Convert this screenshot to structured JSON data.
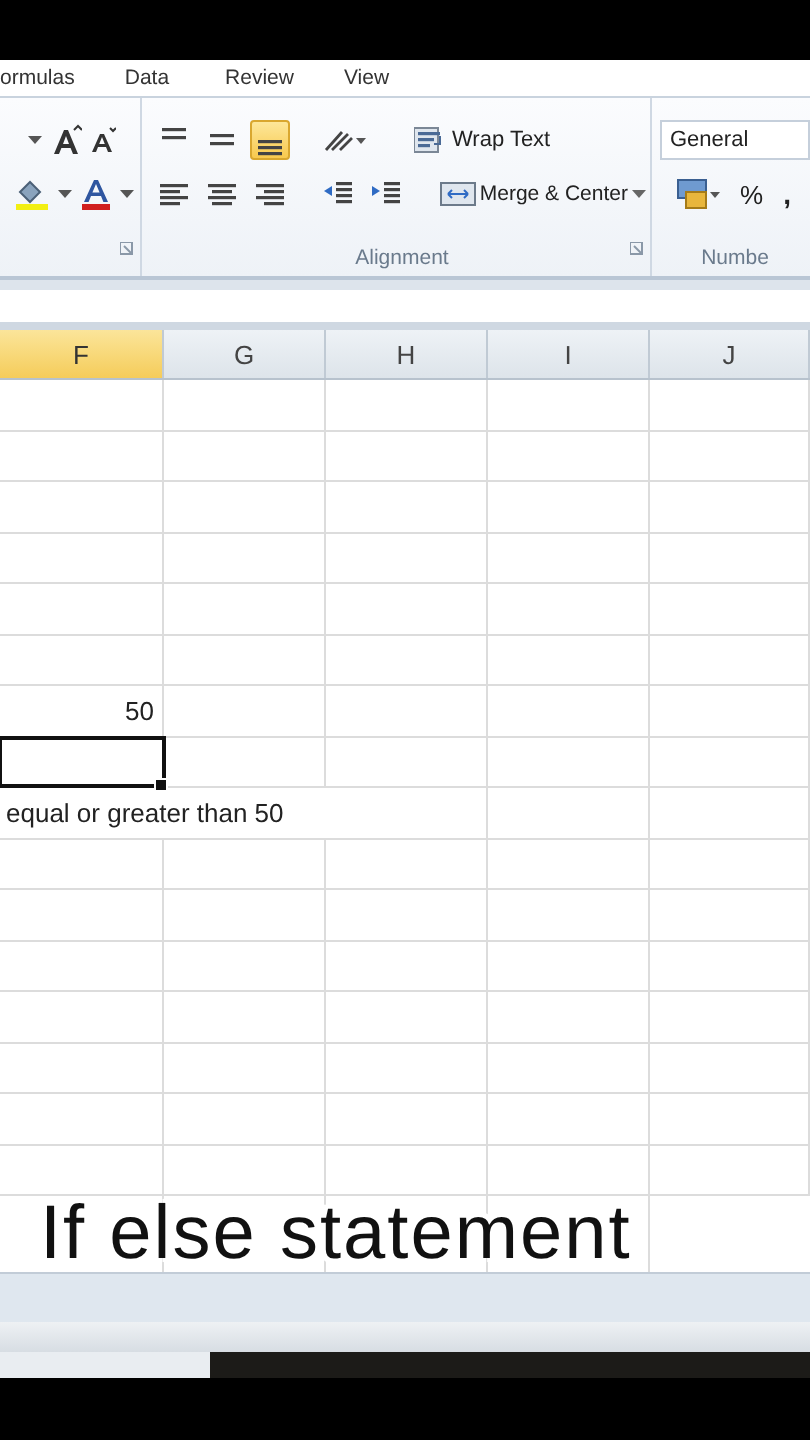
{
  "ribbon_tabs": [
    {
      "label": "ormulas"
    },
    {
      "label": "Data"
    },
    {
      "label": "Review"
    },
    {
      "label": "View"
    }
  ],
  "alignment": {
    "vertical": [
      {
        "selected": false
      },
      {
        "selected": false
      },
      {
        "selected": true
      }
    ],
    "wrap_text": "Wrap Text",
    "merge_center": "Merge & Center",
    "label": "Alignment"
  },
  "number": {
    "format": "General",
    "percent": "%",
    "comma": ",",
    "label": "Numbe"
  },
  "columns": [
    {
      "label": "F",
      "selected": true
    },
    {
      "label": "G",
      "selected": false
    },
    {
      "label": "H",
      "selected": false
    },
    {
      "label": "I",
      "selected": false
    },
    {
      "label": "J",
      "selected": false
    }
  ],
  "rows": [
    {
      "selected": false
    },
    {
      "selected": false
    },
    {
      "selected": false
    },
    {
      "selected": false
    },
    {
      "selected": false
    },
    {
      "selected": false
    },
    {
      "selected": false,
      "F": "50"
    },
    {
      "selected": true
    },
    {
      "selected": false,
      "F": "equal or greater than 50"
    },
    {
      "selected": false
    },
    {
      "selected": false
    },
    {
      "selected": false
    },
    {
      "selected": false
    },
    {
      "selected": false
    },
    {
      "selected": false
    },
    {
      "selected": false
    }
  ],
  "caption": "If else statement"
}
